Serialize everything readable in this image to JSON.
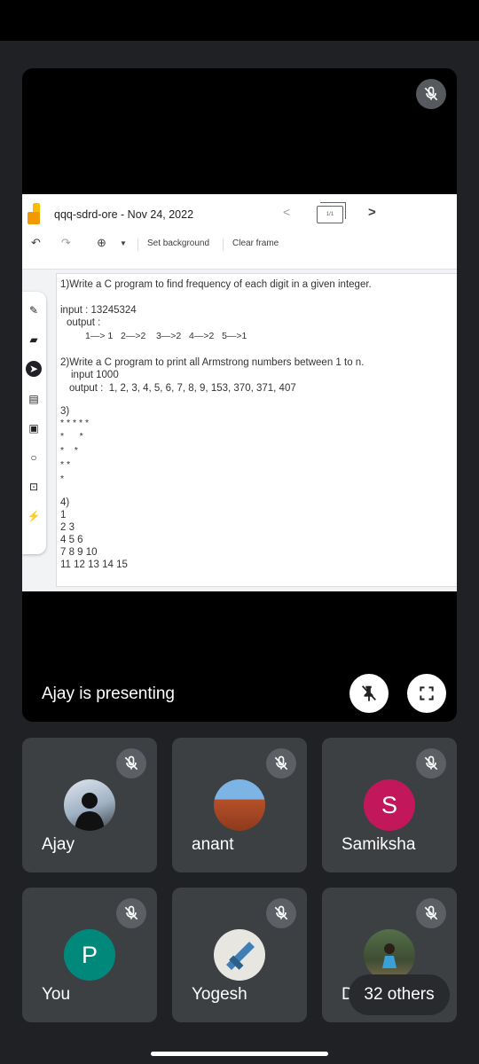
{
  "board": {
    "title": "qqq-sdrd-ore - Nov 24, 2022",
    "frame_indicator": "1/1",
    "toolbar": {
      "set_background": "Set background",
      "clear_frame": "Clear frame"
    },
    "lines": [
      "1)Write a C program to find frequency of each digit in a given integer.",
      "input : 13245324",
      "output :",
      "1—> 1   2—>2    3—>2   4—>2   5—>1",
      "2)Write a C program to print all Armstrong numbers between 1 to n.",
      "input 1000",
      "output :  1, 2, 3, 4, 5, 6, 7, 8, 9, 153, 370, 371, 407",
      "3)",
      "* * * * *",
      "*      *",
      "*    *",
      "* *",
      "*",
      "4)",
      "1",
      "2 3",
      "4 5 6",
      "7 8 9 10",
      "11 12 13 14 15"
    ]
  },
  "presenting_label": "Ajay is presenting",
  "participants": [
    {
      "name": "Ajay"
    },
    {
      "name": "anant"
    },
    {
      "name": "Samiksha",
      "initial": "S",
      "color": "#c2185b"
    },
    {
      "name": "You",
      "initial": "P",
      "color": "#00897b"
    },
    {
      "name": "Yogesh"
    },
    {
      "name": "Di"
    }
  ],
  "others_chip": "32 others",
  "colors": {
    "background": "#202124",
    "tile": "#3c4043",
    "mic_badge": "#5f6368"
  }
}
